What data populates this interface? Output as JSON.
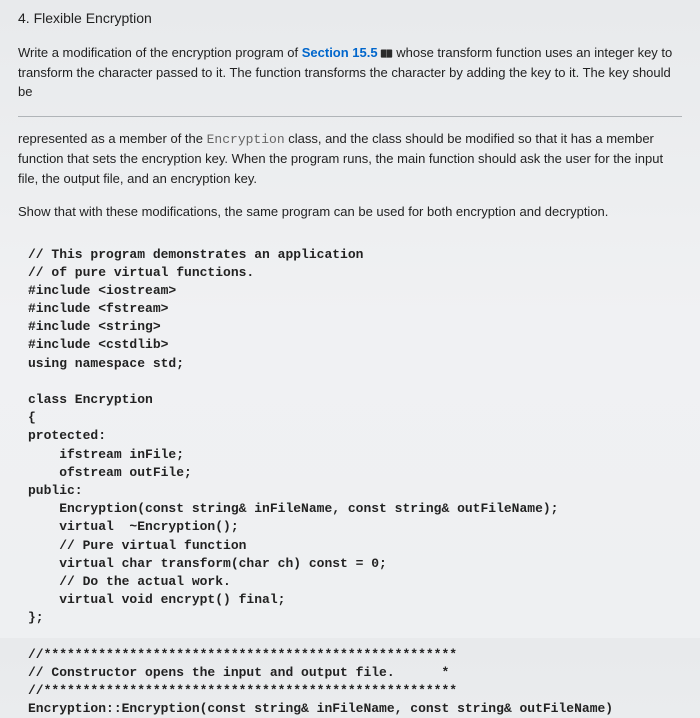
{
  "title": "4. Flexible Encryption",
  "intro_prefix": "Write a modification of the encryption program of ",
  "section_link": "Section 15.5",
  "book_icon": "book-icon",
  "intro_suffix": " whose transform function uses an integer key to transform the character passed to it. The function transforms the character by adding the key to it. The key should be",
  "para2_a": "represented as a member of the ",
  "encryption_word": "Encryption",
  "para2_b": " class, and the class should be modified so that it has a member function that sets the encryption key. When the program runs, the main function should ask the user for the input file, the output file, and an encryption key.",
  "para3": "Show that with these modifications, the same program can be used for both encryption and decryption.",
  "code": "// This program demonstrates an application\n// of pure virtual functions.\n#include <iostream>\n#include <fstream>\n#include <string>\n#include <cstdlib>\nusing namespace std;\n\nclass Encryption\n{\nprotected:\n    ifstream inFile;\n    ofstream outFile;\npublic:\n    Encryption(const string& inFileName, const string& outFileName);\n    virtual  ~Encryption();\n    // Pure virtual function\n    virtual char transform(char ch) const = 0;\n    // Do the actual work.\n    virtual void encrypt() final;\n};\n\n//*****************************************************\n// Constructor opens the input and output file.      *\n//*****************************************************\nEncryption::Encryption(const string& inFileName, const string& outFileName)"
}
